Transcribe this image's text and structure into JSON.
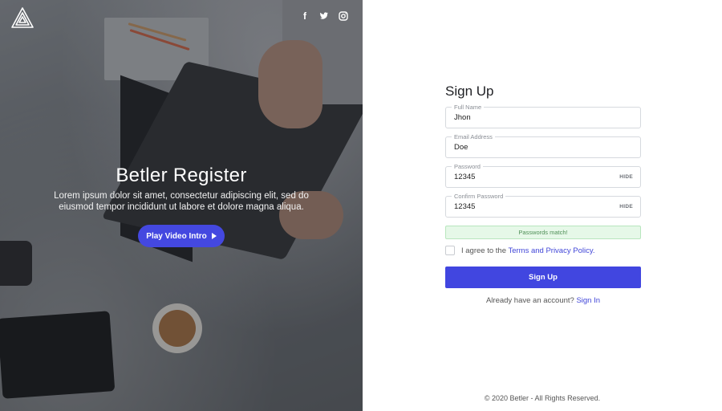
{
  "hero": {
    "title": "Betler Register",
    "description": "Lorem ipsum dolor sit amet, consectetur adipiscing elit, sed do eiusmod tempor incididunt ut labore et dolore magna aliqua.",
    "play_button": "Play Video Intro",
    "socials": [
      "facebook-icon",
      "twitter-icon",
      "instagram-icon"
    ]
  },
  "form": {
    "title": "Sign Up",
    "fields": [
      {
        "label": "Full Name",
        "value": "Jhon",
        "toggle": ""
      },
      {
        "label": "Email Address",
        "value": "Doe",
        "toggle": ""
      },
      {
        "label": "Password",
        "value": "12345",
        "toggle": "HIDE"
      },
      {
        "label": "Confirm Password",
        "value": "12345",
        "toggle": "HIDE"
      }
    ],
    "match_message": "Passwords match!",
    "agree_prefix": "I agree to the",
    "agree_link": "Terms and Privacy Policy.",
    "submit": "Sign Up",
    "already_text": "Already have an account?",
    "signin_link": "Sign In"
  },
  "footer": "© 2020 Betler - All Rights Reserved.",
  "colors": {
    "accent": "#4146e0",
    "success_bg": "#e6f8e8",
    "success_text": "#4f8f57"
  }
}
